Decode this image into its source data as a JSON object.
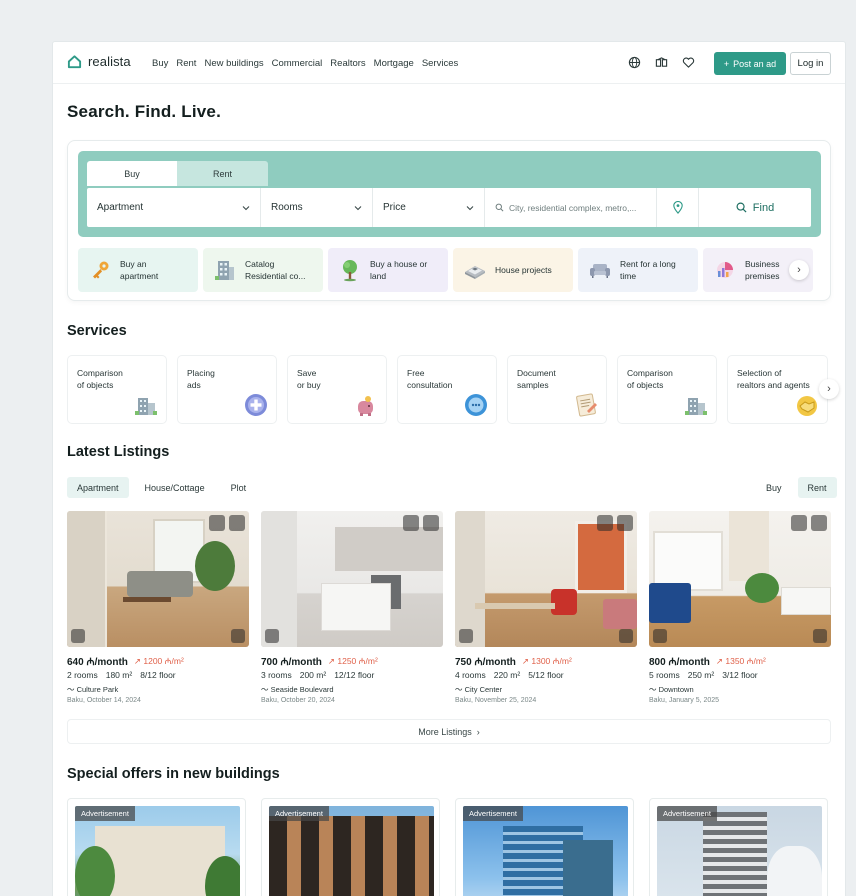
{
  "header": {
    "brand": "realista",
    "nav": [
      "Buy",
      "Rent",
      "New buildings",
      "Commercial",
      "Realtors",
      "Mortgage",
      "Services"
    ],
    "post_label": "Post an ad",
    "login_label": "Log in"
  },
  "hero": {
    "title": "Search. Find. Live."
  },
  "search": {
    "tabs": [
      "Buy",
      "Rent"
    ],
    "type_value": "Apartment",
    "rooms_value": "Rooms",
    "price_value": "Price",
    "location_placeholder": "City, residential complex, metro,...",
    "find_label": "Find",
    "categories": [
      {
        "line1": "Buy an",
        "line2": "apartment",
        "bg": "#e7f5f1",
        "icon": "key-icon"
      },
      {
        "line1": "Catalog",
        "line2": "Residential co...",
        "bg": "#eef7ee",
        "icon": "building-icon"
      },
      {
        "line1": "Buy a house or",
        "line2": "land",
        "bg": "#f0edf9",
        "icon": "tree-icon"
      },
      {
        "line1": "House projects",
        "line2": "",
        "bg": "#fbf4e6",
        "icon": "blueprint-icon"
      },
      {
        "line1": "Rent for a long",
        "line2": "time",
        "bg": "#eef2f9",
        "icon": "sofa-icon"
      },
      {
        "line1": "Business",
        "line2": "premises",
        "bg": "#f3f0f8",
        "icon": "chart-icon"
      }
    ]
  },
  "services": {
    "title": "Services",
    "items": [
      {
        "line1": "Comparison",
        "line2": "of objects",
        "icon": "building-compare-icon"
      },
      {
        "line1": "Placing",
        "line2": "ads",
        "icon": "plus-badge-icon"
      },
      {
        "line1": "Save",
        "line2": "or buy",
        "icon": "piggy-bank-icon"
      },
      {
        "line1": "Free",
        "line2": "consultation",
        "icon": "chat-bubble-icon"
      },
      {
        "line1": "Document",
        "line2": "samples",
        "icon": "document-icon"
      },
      {
        "line1": "Comparison",
        "line2": "of objects",
        "icon": "building-compare-icon"
      },
      {
        "line1": "Selection of",
        "line2": "realtors and agents",
        "icon": "handshake-icon"
      }
    ]
  },
  "listings": {
    "title": "Latest Listings",
    "type_tabs": [
      "Apartment",
      "House/Cottage",
      "Plot"
    ],
    "deal_tabs": [
      "Buy",
      "Rent"
    ],
    "items": [
      {
        "price": "640 ₼/month",
        "ppm": "1200 ₼/m²",
        "rooms": "2 rooms",
        "area": "180 m²",
        "floor": "8/12 floor",
        "place": "Culture Park",
        "date": "Baku, October 14, 2024"
      },
      {
        "price": "700 ₼/month",
        "ppm": "1250 ₼/m²",
        "rooms": "3 rooms",
        "area": "200 m²",
        "floor": "12/12 floor",
        "place": "Seaside Boulevard",
        "date": "Baku, October 20, 2024"
      },
      {
        "price": "750 ₼/month",
        "ppm": "1300 ₼/m²",
        "rooms": "4 rooms",
        "area": "220 m²",
        "floor": "5/12 floor",
        "place": "City Center",
        "date": "Baku, November 25, 2024"
      },
      {
        "price": "800 ₼/month",
        "ppm": "1350 ₼/m²",
        "rooms": "5 rooms",
        "area": "250 m²",
        "floor": "3/12 floor",
        "place": "Downtown",
        "date": "Baku, January 5, 2025"
      }
    ],
    "more_label": "More Listings"
  },
  "offers": {
    "title": "Special offers in new buildings",
    "tag": "Advertisement",
    "count_tags": [
      "Advertisement",
      "Advertisement",
      "Advertisement",
      "Advertisement"
    ]
  },
  "colors": {
    "accent": "#2e9a88",
    "search_band": "#8fccbf",
    "price_per_meter": "#e0614a"
  }
}
